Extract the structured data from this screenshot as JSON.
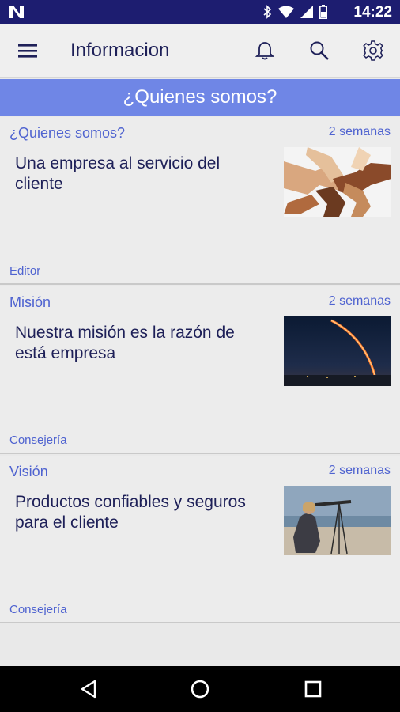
{
  "status_bar": {
    "time": "14:22"
  },
  "app_bar": {
    "title": "Informacion"
  },
  "section": {
    "title": "¿Quienes somos?"
  },
  "cards": [
    {
      "category": "¿Quienes somos?",
      "date": "2 semanas",
      "headline": "Una empresa al servicio del cliente",
      "author": "Editor",
      "image": "hands-teamwork-photo"
    },
    {
      "category": "Misión",
      "date": "2 semanas",
      "headline": "Nuestra misión es la razón de está empresa",
      "author": "Consejería",
      "image": "rocket-launch-photo"
    },
    {
      "category": "Visión",
      "date": "2 semanas",
      "headline": "Productos confiables y seguros para el cliente",
      "author": "Consejería",
      "image": "telescope-beach-photo"
    }
  ],
  "colors": {
    "status_bar": "#1d1d70",
    "accent": "#6f86e6",
    "link": "#4f63d0",
    "text": "#1e2058"
  }
}
